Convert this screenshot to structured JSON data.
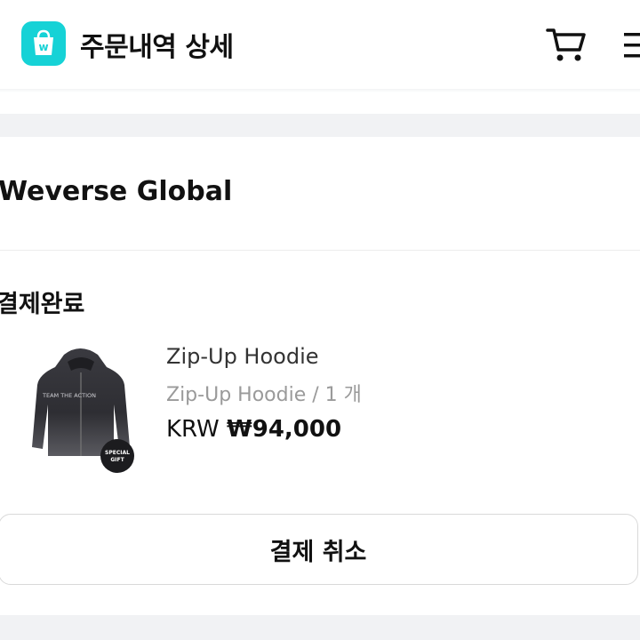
{
  "header": {
    "title": "주문내역 상세",
    "logo_icon": "weverse-shop-logo",
    "cart_icon": "cart-icon",
    "menu_icon": "menu-icon"
  },
  "store": {
    "name": "Weverse Global"
  },
  "order": {
    "status": "결제완료",
    "item": {
      "name": "Zip-Up Hoodie",
      "option": "Zip-Up Hoodie / 1 개",
      "currency": "KRW",
      "price": "₩94,000",
      "badge": "SPECIAL GIFT",
      "print_text": "TEAM THE ACTION"
    }
  },
  "actions": {
    "cancel_label": "결제 취소"
  },
  "colors": {
    "accent": "#16d2d6",
    "band": "#f1f2f4"
  }
}
